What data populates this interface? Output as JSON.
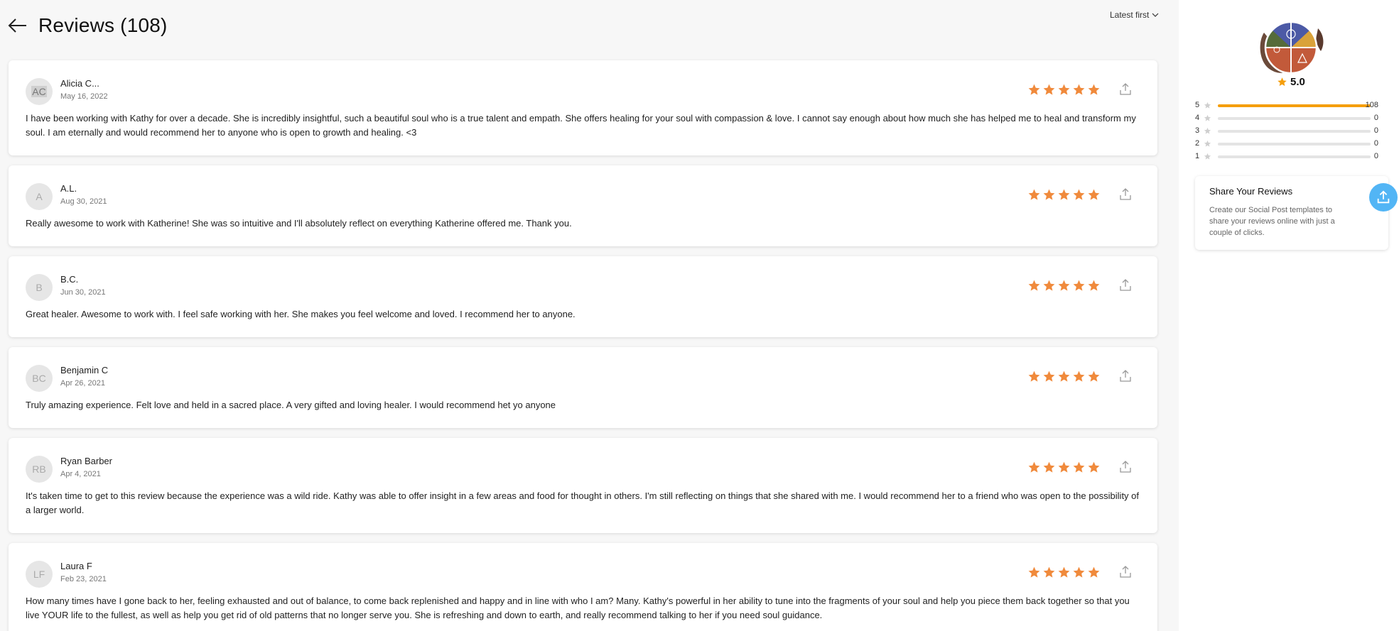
{
  "header": {
    "title": "Reviews (108)",
    "sort_label": "Latest first"
  },
  "reviews": [
    {
      "initials": "AC",
      "name": "Alicia C...",
      "date": "May 16, 2022",
      "rating": 5,
      "text": "I have been working with Kathy for over a decade. She is incredibly insightful, such a beautiful soul who is a true talent and empath. She offers healing for your soul with compassion & love. I cannot say enough about how much she has helped me to heal and transform my soul. I am eternally and would recommend her to anyone who is open to growth and healing. <3"
    },
    {
      "initials": "A",
      "name": "A.L.",
      "date": "Aug 30, 2021",
      "rating": 5,
      "text": "Really awesome to work with Katherine! She was so intuitive and I'll absolutely reflect on everything Katherine offered me. Thank you."
    },
    {
      "initials": "B",
      "name": "B.C.",
      "date": "Jun 30, 2021",
      "rating": 5,
      "text": "Great healer. Awesome to work with. I feel safe working with her. She makes you feel welcome and loved. I recommend her to anyone."
    },
    {
      "initials": "BC",
      "name": "Benjamin C",
      "date": "Apr 26, 2021",
      "rating": 5,
      "text": "Truly amazing experience. Felt love and held in a sacred place. A very gifted and loving healer. I would recommend het yo anyone"
    },
    {
      "initials": "RB",
      "name": "Ryan Barber",
      "date": "Apr 4, 2021",
      "rating": 5,
      "text": "It's taken time to get to this review because the experience was a wild ride. Kathy was able to offer insight in a few areas and food for thought in others. I'm still reflecting on things that she shared with me. I would recommend her to a friend who was open to the possibility of a larger world."
    },
    {
      "initials": "LF",
      "name": "Laura F",
      "date": "Feb 23, 2021",
      "rating": 5,
      "text": "How many times have I gone back to her, feeling exhausted and out of balance, to come back replenished and happy and in line with who I am? Many. Kathy's powerful in her ability to tune into the fragments of your soul and help you piece them back together so that you live YOUR life to the fullest, as well as help you get rid of old patterns that no longer serve you. She is refreshing and down to earth, and really recommend talking to her if you need soul guidance."
    }
  ],
  "summary": {
    "average": "5.0",
    "distribution": [
      {
        "stars": "5",
        "count": "108",
        "fraction": 1.0
      },
      {
        "stars": "4",
        "count": "0",
        "fraction": 0
      },
      {
        "stars": "3",
        "count": "0",
        "fraction": 0
      },
      {
        "stars": "2",
        "count": "0",
        "fraction": 0
      },
      {
        "stars": "1",
        "count": "0",
        "fraction": 0
      }
    ]
  },
  "share_card": {
    "title": "Share Your Reviews",
    "description": "Create our Social Post templates to share your reviews online with just a couple of clicks."
  },
  "colors": {
    "star": "#f08a3c",
    "bar_fill": "#f59e0b",
    "share_button": "#52b5f5"
  },
  "icons": {
    "back": "arrow-left-icon",
    "sort": "chevron-down-icon",
    "star": "star-icon",
    "share": "share-upload-icon",
    "logo": "elements-logo"
  }
}
